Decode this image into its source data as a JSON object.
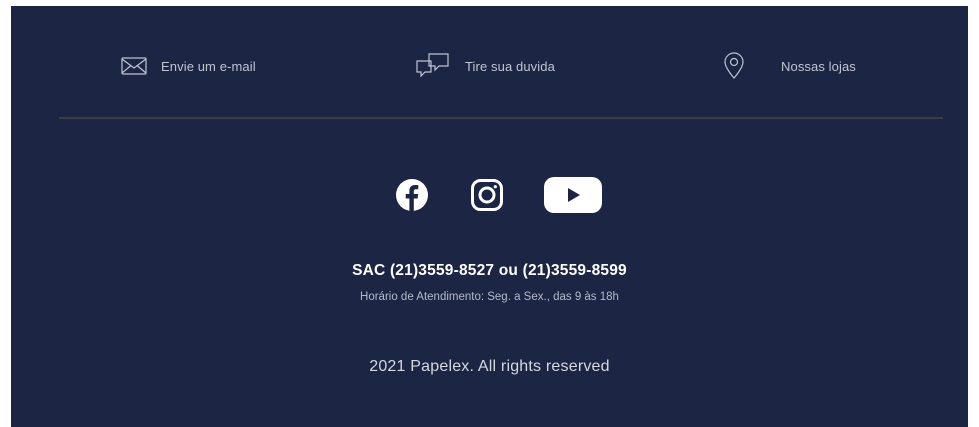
{
  "footer": {
    "background_color": "#1c2543",
    "contact_links": [
      {
        "icon": "envelope-icon",
        "label": "Envie um e-mail"
      },
      {
        "icon": "chat-bubbles-icon",
        "label": "Tire sua duvida"
      },
      {
        "icon": "map-pin-icon",
        "label": "Nossas lojas"
      }
    ],
    "social": [
      {
        "icon": "facebook-icon",
        "network": "Facebook"
      },
      {
        "icon": "instagram-icon",
        "network": "Instagram"
      },
      {
        "icon": "youtube-icon",
        "network": "YouTube"
      }
    ],
    "sac": {
      "phones": "SAC (21)3559-8527 ou (21)3559-8599",
      "hours": "Horário de Atendimento: Seg. a Sex., das 9 às 18h"
    },
    "copyright": "2021 Papelex. All rights reserved"
  }
}
